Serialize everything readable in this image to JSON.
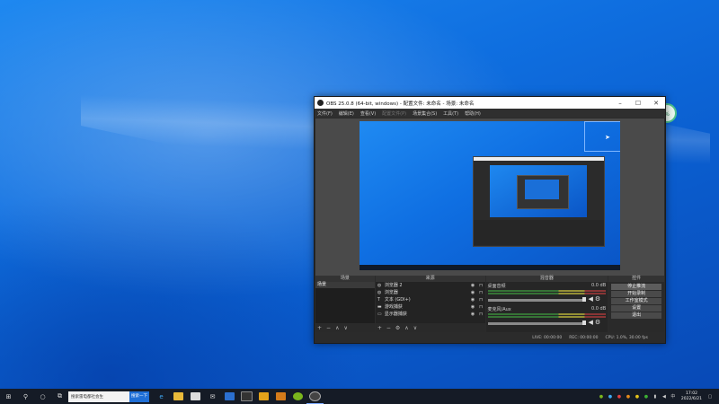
{
  "window": {
    "title": "OBS 25.0.8 (64-bit, windows) - 配置文件: 未命名 - 场景: 未命名",
    "menu": [
      "文件(F)",
      "编辑(E)",
      "查看(V)",
      "配置文件(P)",
      "场景集合(S)",
      "工具(T)",
      "帮助(H)"
    ]
  },
  "docks": {
    "scenes": {
      "title": "场景",
      "items": [
        "场景"
      ]
    },
    "sources": {
      "title": "来源",
      "items": [
        {
          "icon": "globe-icon",
          "name": "浏览器 2"
        },
        {
          "icon": "globe-icon",
          "name": "浏览器"
        },
        {
          "icon": "text-icon",
          "name": "文本 (GDI+)"
        },
        {
          "icon": "camera-icon",
          "name": "游戏捕获"
        },
        {
          "icon": "monitor-icon",
          "name": "显示器捕获"
        }
      ]
    },
    "mixer": {
      "title": "混音器",
      "channels": [
        {
          "name": "桌面音频",
          "level": "0.0 dB"
        },
        {
          "name": "麦克风/Aux",
          "level": "0.0 dB"
        }
      ]
    },
    "controls": {
      "title": "控件",
      "buttons": [
        "停止推流",
        "开始录制",
        "工作室模式",
        "设置",
        "退出"
      ]
    }
  },
  "status": {
    "live": "LIVE: 00:00:00",
    "rec": "REC: 00:00:00",
    "cpu": "CPU: 1.0%, 30.00 fps"
  },
  "taskbar": {
    "search_text": "搜索雷电都社会生",
    "search_button": "搜索一下",
    "time": "17:02",
    "date": "2022/6/21"
  },
  "widget": {
    "label": "%"
  }
}
